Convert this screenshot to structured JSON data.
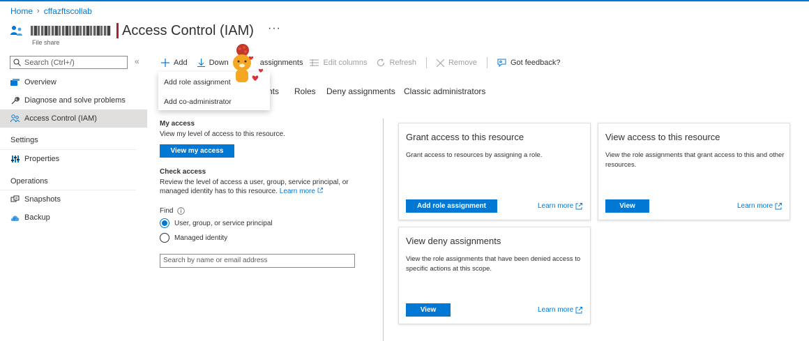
{
  "breadcrumb": {
    "home": "Home",
    "resource": "cffazftscollab"
  },
  "header": {
    "title": "Access Control (IAM)",
    "subtitle": "File share",
    "more": "···"
  },
  "sidebar": {
    "search_placeholder": "Search (Ctrl+/)",
    "collapse": "«",
    "items": [
      {
        "label": "Overview",
        "icon": "overview-icon"
      },
      {
        "label": "Diagnose and solve problems",
        "icon": "wrench-icon"
      },
      {
        "label": "Access Control (IAM)",
        "icon": "people-icon"
      }
    ],
    "sections": [
      {
        "label": "Settings",
        "items": [
          {
            "label": "Properties",
            "icon": "properties-icon"
          }
        ]
      },
      {
        "label": "Operations",
        "items": [
          {
            "label": "Snapshots",
            "icon": "snapshot-icon"
          },
          {
            "label": "Backup",
            "icon": "backup-cloud-icon"
          }
        ]
      }
    ]
  },
  "toolbar": {
    "add": "Add",
    "download": "Download role assignments",
    "download_visible_left": "Down",
    "download_visible_right": "assignments",
    "edit_columns": "Edit columns",
    "refresh": "Refresh",
    "remove": "Remove",
    "feedback": "Got feedback?"
  },
  "dropdown": {
    "items": [
      "Add role assignment",
      "Add co-administrator"
    ]
  },
  "tabs": {
    "partial": "nts",
    "roles": "Roles",
    "deny": "Deny assignments",
    "classic": "Classic administrators"
  },
  "my_access": {
    "title": "My access",
    "desc": "View my level of access to this resource.",
    "button": "View my access"
  },
  "check_access": {
    "title": "Check access",
    "desc_line1": "Review the level of access a user, group, service principal, or",
    "desc_line2": "managed identity has to this resource.",
    "learn_more": "Learn more",
    "find": "Find",
    "options": [
      "User, group, or service principal",
      "Managed identity"
    ],
    "search_placeholder": "Search by name or email address"
  },
  "cards": {
    "grant": {
      "title": "Grant access to this resource",
      "desc": "Grant access to resources by assigning a role.",
      "button": "Add role assignment",
      "link": "Learn more"
    },
    "view": {
      "title": "View access to this resource",
      "desc": "View the role assignments that grant access to this and other resources.",
      "button": "View",
      "link": "Learn more"
    },
    "deny": {
      "title": "View deny assignments",
      "desc": "View the role assignments that have been denied access to specific actions at this scope.",
      "button": "View",
      "link": "Learn more"
    }
  },
  "colors": {
    "accent": "#0078d4",
    "title_bar": "#a4262c",
    "active_nav": "#e1dfdd"
  }
}
